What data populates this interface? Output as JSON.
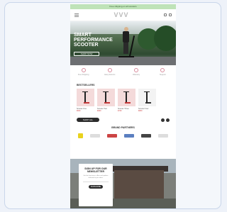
{
  "promo": {
    "text": "Free shipping on all scooters"
  },
  "header": {
    "logo": "VVV"
  },
  "hero": {
    "title": "SMART PERFORMANCE SCOOTER",
    "cta": "SHOP NOW"
  },
  "features": [
    {
      "label": "Free Shipping"
    },
    {
      "label": "Easy Returns"
    },
    {
      "label": "Warranty"
    },
    {
      "label": "Support"
    }
  ],
  "bestsellers": {
    "title": "BESTSELLERS"
  },
  "products": [
    {
      "name": "Scooter One",
      "price": "$599"
    },
    {
      "name": "Scooter Two",
      "price": "$699"
    },
    {
      "name": "Scooter Three",
      "price": "$799"
    },
    {
      "name": "Scooter Four",
      "price": "$899"
    }
  ],
  "shop_all": "SHOP ALL",
  "partners": {
    "title": "BRAND PARTNERS"
  },
  "newsletter": {
    "title": "SIGN UP FOR OUR NEWSLETTER",
    "text": "Get the latest news, offers and updates delivered to your inbox.",
    "button": "SUBSCRIBE"
  },
  "colors": {
    "promo": "#bfe3b8",
    "accent": "#d05050",
    "dark": "#2b2b2b"
  }
}
